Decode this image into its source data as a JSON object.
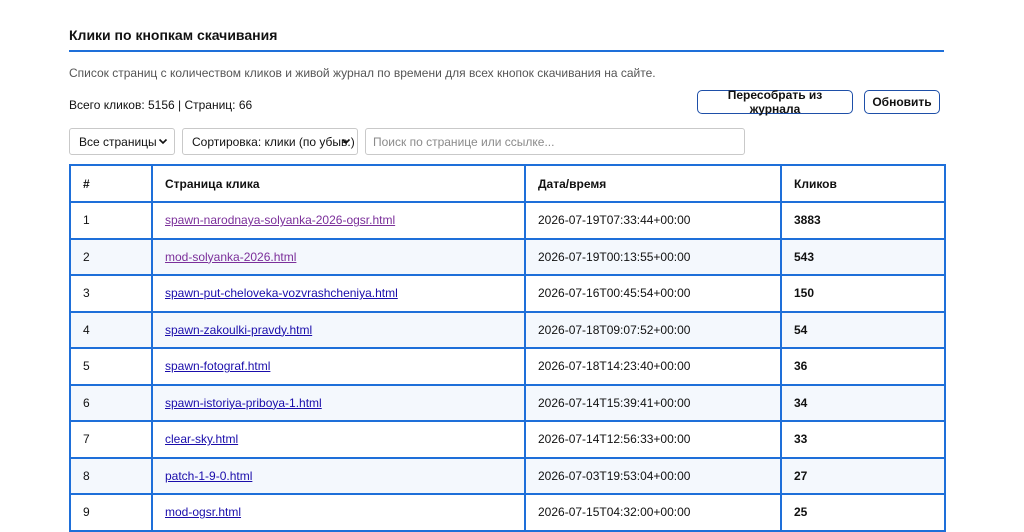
{
  "header": {
    "title": "Клики по кнопкам скачивания",
    "description": "Список страниц с количеством кликов и живой журнал по времени для всех кнопок скачивания на сайте.",
    "stats": "Всего кликов: 5156 | Страниц: 66"
  },
  "actions": {
    "rebuild_label": "Пересобрать из журнала",
    "refresh_label": "Обновить"
  },
  "filters": {
    "pages_select": "Все страницы",
    "sort_select": "Сортировка: клики (по убыв.)",
    "search_placeholder": "Поиск по странице или ссылке..."
  },
  "table": {
    "columns": [
      "#",
      "Страница клика",
      "Дата/время",
      "Кликов"
    ],
    "rows": [
      {
        "n": "1",
        "page": "spawn-narodnaya-solyanka-2026-ogsr.html",
        "date": "2026-07-19T07:33:44+00:00",
        "clicks": "3883",
        "visited": true
      },
      {
        "n": "2",
        "page": "mod-solyanka-2026.html",
        "date": "2026-07-19T00:13:55+00:00",
        "clicks": "543",
        "visited": true
      },
      {
        "n": "3",
        "page": "spawn-put-cheloveka-vozvrashcheniya.html",
        "date": "2026-07-16T00:45:54+00:00",
        "clicks": "150",
        "visited": false
      },
      {
        "n": "4",
        "page": "spawn-zakoulki-pravdy.html",
        "date": "2026-07-18T09:07:52+00:00",
        "clicks": "54",
        "visited": false
      },
      {
        "n": "5",
        "page": "spawn-fotograf.html",
        "date": "2026-07-18T14:23:40+00:00",
        "clicks": "36",
        "visited": false
      },
      {
        "n": "6",
        "page": "spawn-istoriya-priboya-1.html",
        "date": "2026-07-14T15:39:41+00:00",
        "clicks": "34",
        "visited": false
      },
      {
        "n": "7",
        "page": "clear-sky.html",
        "date": "2026-07-14T12:56:33+00:00",
        "clicks": "33",
        "visited": false
      },
      {
        "n": "8",
        "page": "patch-1-9-0.html",
        "date": "2026-07-03T19:53:04+00:00",
        "clicks": "27",
        "visited": false
      },
      {
        "n": "9",
        "page": "mod-ogsr.html",
        "date": "2026-07-15T04:32:00+00:00",
        "clicks": "25",
        "visited": false
      }
    ]
  },
  "colors": {
    "accent": "#1e6fd9",
    "button_border": "#1e4fa8",
    "link": "#1a0dab",
    "link_visited": "#7b2f9a"
  },
  "icons": {
    "select_chevron": "chevron-down-icon"
  }
}
